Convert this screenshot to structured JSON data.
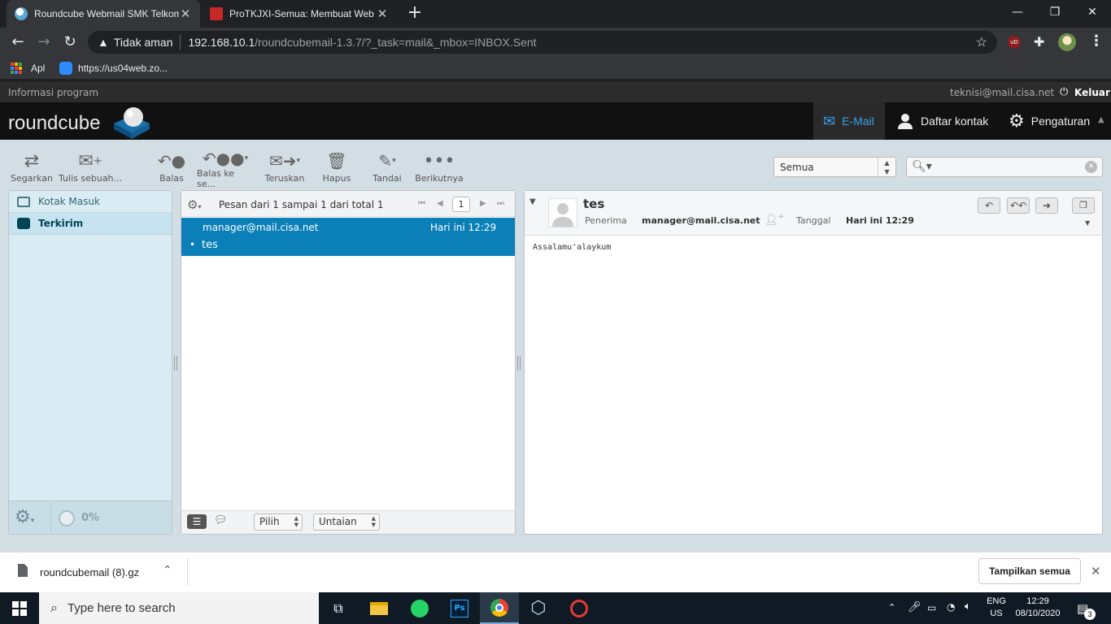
{
  "browser": {
    "tabs": [
      {
        "title": "Roundcube Webmail SMK Telkom"
      },
      {
        "title": "ProTKJXI-Semua: Membuat Web"
      }
    ],
    "security_label": "Tidak aman",
    "url_host": "192.168.10.1",
    "url_path": "/roundcubemail-1.3.7/?_task=mail&_mbox=INBOX.Sent",
    "bookmarks": [
      {
        "label": "Apl"
      },
      {
        "label": "https://us04web.zo..."
      }
    ]
  },
  "topline": {
    "about": "Informasi program",
    "user": "teknisi@mail.cisa.net",
    "logout": "Keluar"
  },
  "header": {
    "logo_text": "roundcube",
    "nav": {
      "mail": "E-Mail",
      "contacts": "Daftar kontak",
      "settings": "Pengaturan"
    }
  },
  "toolbar": {
    "refresh": "Segarkan",
    "compose": "Tulis sebuah...",
    "reply": "Balas",
    "reply_all": "Balas ke se...",
    "forward": "Teruskan",
    "delete": "Hapus",
    "mark": "Tandai",
    "more": "Berikutnya",
    "filter_value": "Semua"
  },
  "folders": [
    {
      "name": "Kotak Masuk",
      "selected": false
    },
    {
      "name": "Terkirim",
      "selected": true
    }
  ],
  "quota": "0%",
  "message_list": {
    "count_text": "Pesan dari 1 sampai 1 dari total 1",
    "page": "1",
    "messages": [
      {
        "from": "manager@mail.cisa.net",
        "date": "Hari ini 12:29",
        "subject": "tes"
      }
    ],
    "select_label": "Pilih",
    "threads_label": "Untaian"
  },
  "preview": {
    "subject": "tes",
    "to_label": "Penerima",
    "to": "manager@mail.cisa.net",
    "date_label": "Tanggal",
    "date": "Hari ini 12:29",
    "body": "Assalamu'alaykum"
  },
  "downloads": {
    "file": "roundcubemail (8).gz",
    "show_all": "Tampilkan semua"
  },
  "taskbar": {
    "search_placeholder": "Type here to search",
    "lang": "ENG",
    "region": "US",
    "time": "12:29",
    "date": "08/10/2020",
    "notifications": "3"
  },
  "colors": {
    "accent": "#0b7fb8",
    "nav_active": "#3aa0e8",
    "folder_bg": "#d9ecf4"
  }
}
